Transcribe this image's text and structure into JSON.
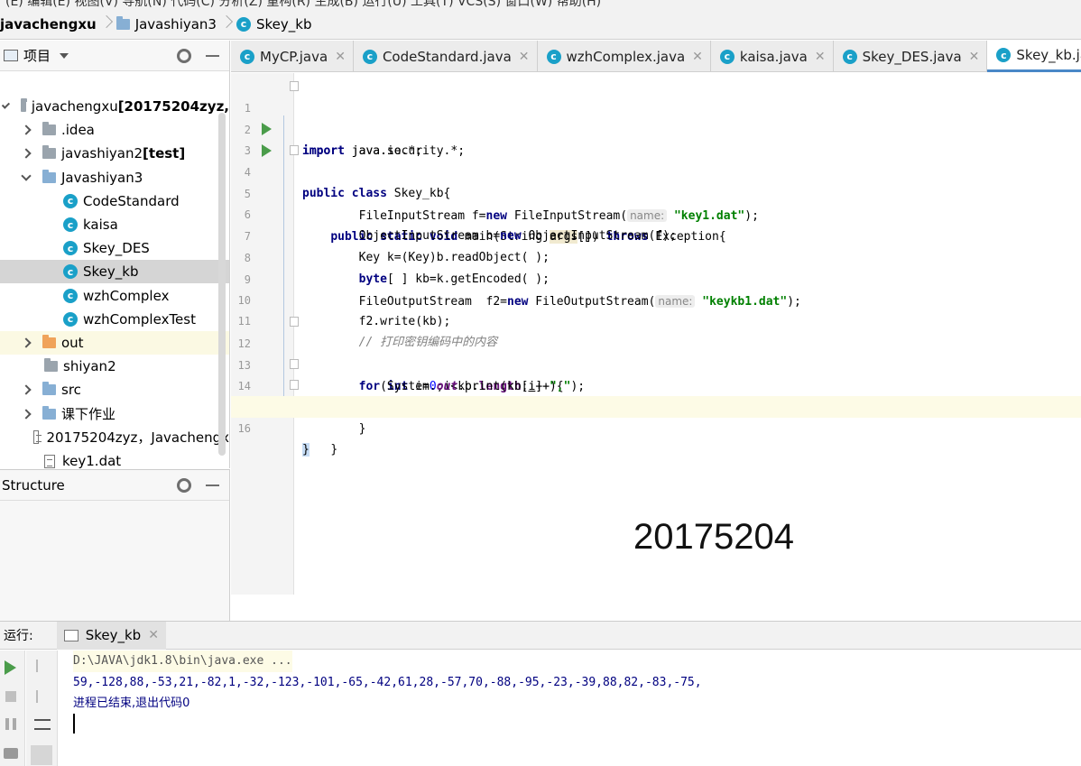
{
  "menubar": {
    "text": "(E)   编辑(E)   视图(V)   导航(N)   代码(C)   分析(Z)   重构(R)   生成(B)   运行(U)   工具(T)   VCS(S)   窗口(W)   帮助(H)"
  },
  "breadcrumb": {
    "project": "javachengxu",
    "module": "Javashiyan3",
    "file": "Skey_kb"
  },
  "project_panel": {
    "title": "项目",
    "tree": [
      {
        "label": "javachengxu",
        "suffix": " [20175204zyz,",
        "indent": 0,
        "arrow": "down",
        "icon": "module"
      },
      {
        "label": ".idea",
        "indent": 1,
        "arrow": "right",
        "icon": "folder-gray"
      },
      {
        "label": "javashiyan2",
        "suffix": " [test]",
        "indent": 1,
        "arrow": "right",
        "icon": "module"
      },
      {
        "label": "Javashiyan3",
        "indent": 1,
        "arrow": "down",
        "icon": "folder"
      },
      {
        "label": "CodeStandard",
        "indent": 2,
        "icon": "class"
      },
      {
        "label": "kaisa",
        "indent": 2,
        "icon": "class"
      },
      {
        "label": "Skey_DES",
        "indent": 2,
        "icon": "class"
      },
      {
        "label": "Skey_kb",
        "indent": 2,
        "icon": "class",
        "selected": true
      },
      {
        "label": "wzhComplex",
        "indent": 2,
        "icon": "class"
      },
      {
        "label": "wzhComplexTest",
        "indent": 2,
        "icon": "class"
      },
      {
        "label": "out",
        "indent": 1,
        "arrow": "right",
        "icon": "folder-orange",
        "highlight": true
      },
      {
        "label": "shiyan2",
        "indent": 1,
        "icon": "folder-gray"
      },
      {
        "label": "src",
        "indent": 1,
        "arrow": "right",
        "icon": "folder"
      },
      {
        "label": "课下作业",
        "indent": 1,
        "arrow": "right",
        "icon": "folder"
      },
      {
        "label": "20175204zyz，Javachengx",
        "indent": 1,
        "icon": "file"
      },
      {
        "label": "key1.dat",
        "indent": 1,
        "icon": "file"
      },
      {
        "label": "keykb1.dat",
        "indent": 1,
        "icon": "file"
      }
    ]
  },
  "structure_panel": {
    "title": "Structure"
  },
  "editor_tabs": [
    {
      "label": "MyCP.java"
    },
    {
      "label": "CodeStandard.java"
    },
    {
      "label": "wzhComplex.java"
    },
    {
      "label": "kaisa.java"
    },
    {
      "label": "Skey_DES.java"
    },
    {
      "label": "Skey_kb.java",
      "active": true
    }
  ],
  "code": {
    "line_numbers": [
      "1",
      "2",
      "3",
      "4",
      "5",
      "6",
      "7",
      "8",
      "9",
      "10",
      "11",
      "12",
      "13",
      "14",
      "15",
      "16"
    ],
    "l1": [
      "import",
      " java.io.*;"
    ],
    "l2": [
      "import",
      " java.security.*;"
    ],
    "l3": [
      "public class",
      " Skey_kb{"
    ],
    "l4": [
      "public static void",
      " main(String ",
      "args",
      "[]) ",
      "throws",
      " Exception{"
    ],
    "l5": [
      "FileInputStream f=",
      "new",
      " FileInputStream(",
      "name:",
      "\"key1.dat\"",
      ");"
    ],
    "l6": [
      "ObjectInputStream b=",
      "new",
      " ObjectInputStream(f);"
    ],
    "l7": [
      "Key k=(Key)b.readObject( );"
    ],
    "l8": [
      "byte",
      "[ ] kb=k.getEncoded( );"
    ],
    "l9": [
      "FileOutputStream  f2=",
      "new",
      " FileOutputStream(",
      "name:",
      "\"keykb1.dat\"",
      ");"
    ],
    "l10": [
      "f2.write(kb);"
    ],
    "l11": [
      "// 打印密钥编码中的内容"
    ],
    "l12": [
      "for",
      "(",
      "int",
      " i=",
      "0",
      ";i<kb.",
      "length",
      ";i++){"
    ],
    "l13": [
      "System.",
      "out",
      ".print(kb[",
      "i",
      "]+",
      "\",\"",
      ");"
    ],
    "l14": [
      "}"
    ],
    "l15": [
      "}"
    ],
    "l16": [
      "}"
    ]
  },
  "overlay_number": "20175204",
  "run_panel": {
    "label": "运行:",
    "tab": "Skey_kb",
    "cmd": "D:\\JAVA\\jdk1.8\\bin\\java.exe ...",
    "output": "59,-128,88,-53,21,-82,1,-32,-123,-101,-65,-42,61,28,-57,70,-88,-95,-23,-39,88,82,-83,-75,",
    "exit": "进程已结束,退出代码0"
  }
}
